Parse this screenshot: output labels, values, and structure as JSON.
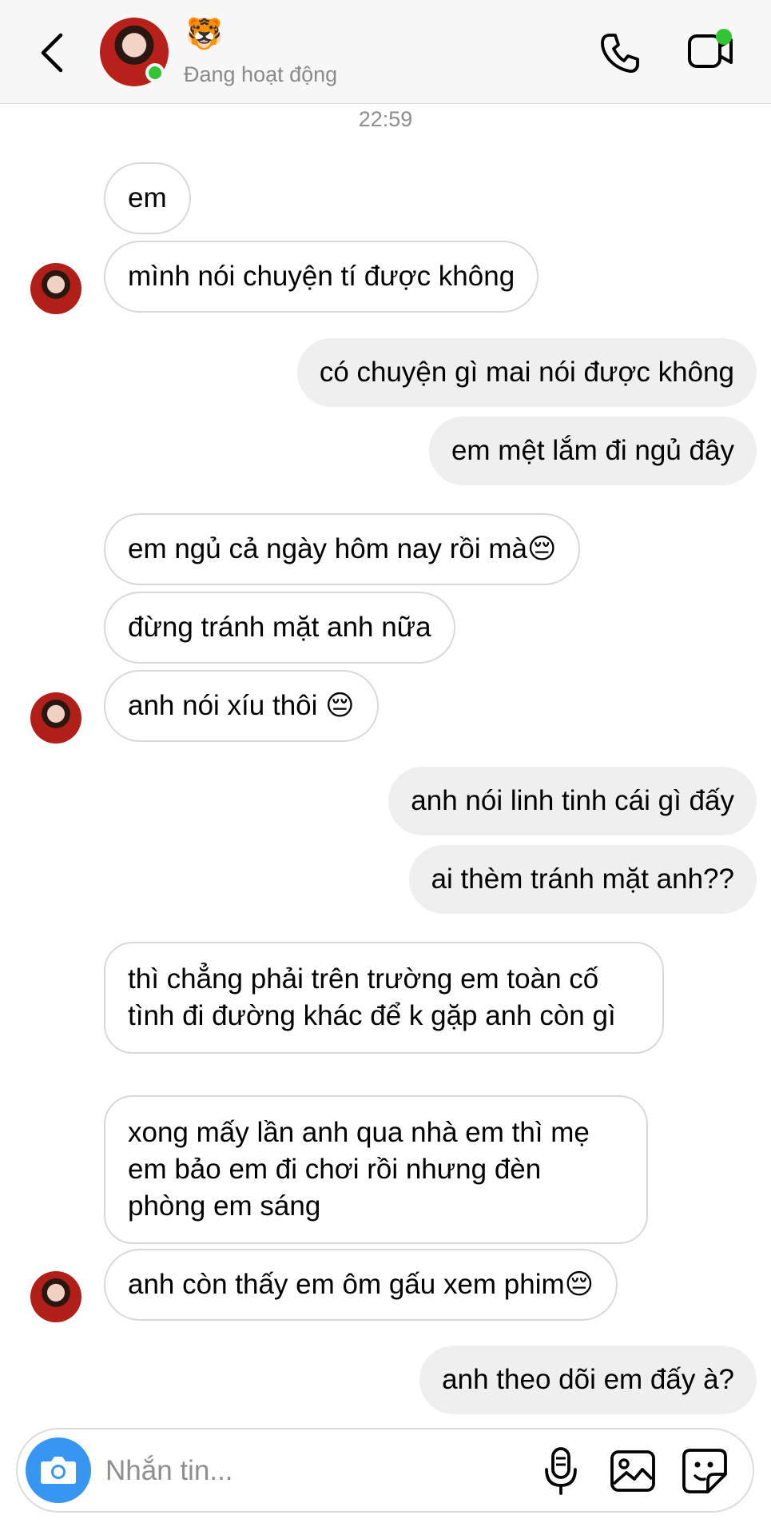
{
  "header": {
    "contact_emoji": "🐯",
    "status": "Đang hoạt động"
  },
  "timestamp": "22:59",
  "messages": [
    {
      "side": "in",
      "text": "em"
    },
    {
      "side": "in",
      "text": "mình nói chuyện tí được không"
    },
    {
      "side": "out",
      "text": "có chuyện gì mai nói được không"
    },
    {
      "side": "out",
      "text": "em mệt lắm đi ngủ đây"
    },
    {
      "side": "in",
      "text": "em ngủ cả ngày hôm nay rồi mà😔"
    },
    {
      "side": "in",
      "text": "đừng tránh mặt anh nữa"
    },
    {
      "side": "in",
      "text": "anh nói xíu thôi 😔"
    },
    {
      "side": "out",
      "text": "anh nói linh tinh cái gì đấy"
    },
    {
      "side": "out",
      "text": "ai thèm tránh mặt anh??"
    },
    {
      "side": "in",
      "text": "thì chẳng phải trên trường em toàn cố tình đi đường khác để k gặp anh còn gì"
    },
    {
      "side": "in",
      "text": "xong mấy lần anh qua nhà em thì mẹ em bảo em đi chơi rồi nhưng đèn phòng em sáng"
    },
    {
      "side": "in",
      "text": "anh còn thấy em ôm gấu xem phim😔"
    },
    {
      "side": "out",
      "text": "anh theo dõi em đấy à?"
    }
  ],
  "composer": {
    "placeholder": "Nhắn tin..."
  },
  "colors": {
    "online": "#31c534",
    "camera_button": "#3896f3",
    "outgoing_bubble": "#efefef"
  }
}
